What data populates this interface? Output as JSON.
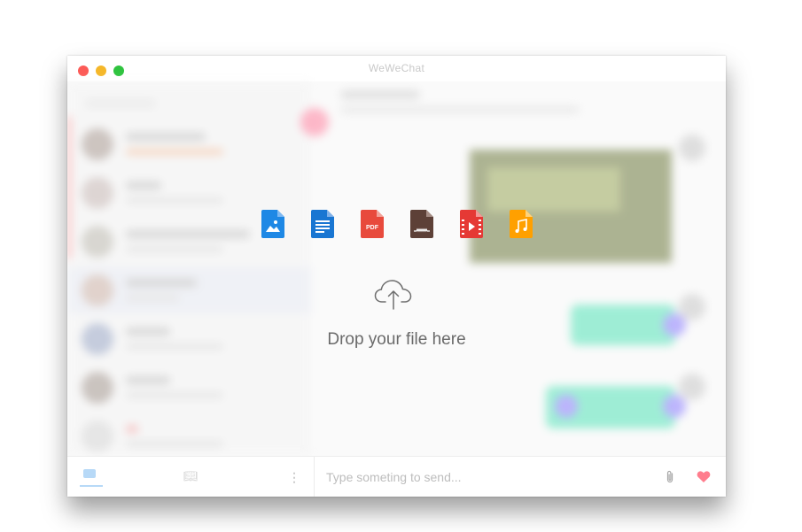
{
  "window": {
    "title": "WeWeChat"
  },
  "drop_zone": {
    "message": "Drop your file here",
    "file_types": [
      {
        "icon": "image-file-icon",
        "color": "#1e88e5"
      },
      {
        "icon": "document-file-icon",
        "color": "#1976d2"
      },
      {
        "icon": "pdf-file-icon",
        "color": "#e84a3c",
        "label": "PDF"
      },
      {
        "icon": "archive-file-icon",
        "color": "#5d4037"
      },
      {
        "icon": "video-file-icon",
        "color": "#e53935"
      },
      {
        "icon": "audio-file-icon",
        "color": "#ffa000"
      }
    ]
  },
  "composer": {
    "placeholder": "Type someting to send..."
  },
  "colors": {
    "accent": "#b7d9f7",
    "heart": "#ff7d8d",
    "drop_text": "#6a6a6a"
  }
}
